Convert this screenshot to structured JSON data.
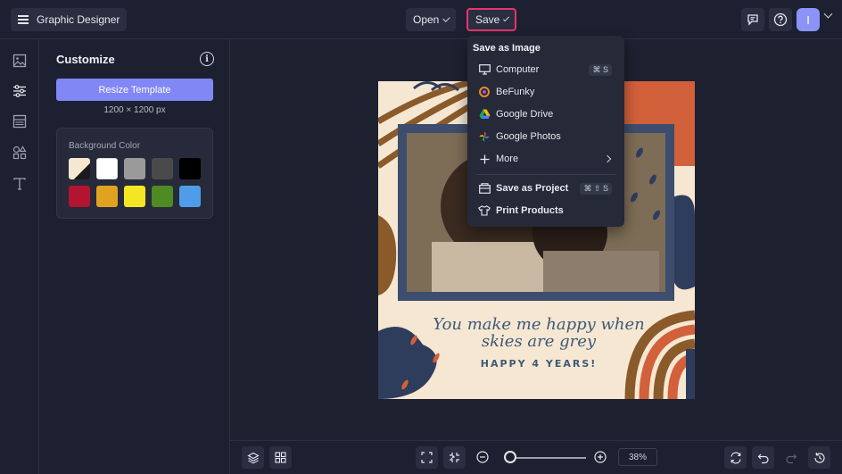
{
  "topbar": {
    "app_name": "Graphic Designer",
    "open_label": "Open",
    "save_label": "Save",
    "avatar_initial": "I"
  },
  "rail": {
    "items": [
      "image-icon",
      "sliders-icon",
      "layout-icon",
      "graphics-icon",
      "text-icon"
    ]
  },
  "panel": {
    "title": "Customize",
    "resize_label": "Resize Template",
    "dimensions": "1200 × 1200 px",
    "bg_label": "Background Color",
    "swatches": [
      "#f6e7d2",
      "#ffffff",
      "#9a9a9a",
      "#4a4a4a",
      "#000000",
      "#b3142f",
      "#e0a321",
      "#f5e625",
      "#4e8b22",
      "#4f9de8"
    ]
  },
  "save_menu": {
    "header": "Save as Image",
    "items": [
      {
        "label": "Computer",
        "icon": "monitor-icon",
        "shortcut": "⌘ S"
      },
      {
        "label": "BeFunky",
        "icon": "befunky-icon",
        "shortcut": ""
      },
      {
        "label": "Google Drive",
        "icon": "google-drive-icon",
        "shortcut": ""
      },
      {
        "label": "Google Photos",
        "icon": "google-photos-icon",
        "shortcut": ""
      },
      {
        "label": "More",
        "icon": "plus-icon",
        "shortcut": ""
      }
    ],
    "project_label": "Save as Project",
    "project_shortcut": "⌘ ⇧ S",
    "print_label": "Print Products"
  },
  "artboard": {
    "text_line1": "You make me happy when",
    "text_line2": "skies are grey",
    "text_line3": "HAPPY 4 YEARS!"
  },
  "bottombar": {
    "zoom": "38%",
    "zoom_value": 0.38
  },
  "colors": {
    "accent": "#8187f5",
    "save_highlight": "#e8336f",
    "navy": "#2f3d5c",
    "orange": "#d2603b",
    "brown": "#8a5a2b",
    "cream": "#f6e7d2"
  }
}
